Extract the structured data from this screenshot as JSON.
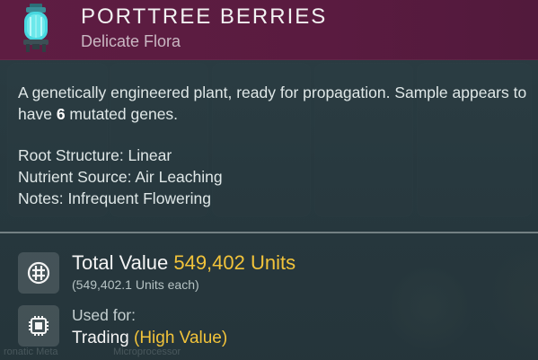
{
  "item": {
    "title": "PORTTREE BERRIES",
    "category": "Delicate Flora",
    "icon": "cryo-capsule-icon"
  },
  "description": {
    "text_before": "A genetically engineered plant, ready for propagation. Sample appears to have ",
    "gene_count": "6",
    "text_after": " mutated genes."
  },
  "properties": [
    "Root Structure: Linear",
    "Nutrient Source: Air Leaching",
    "Notes: Infrequent Flowering"
  ],
  "value": {
    "label": "Total Value",
    "amount": "549,402 Units",
    "each": "(549,402.1 Units each)",
    "icon": "units-currency-icon"
  },
  "usage": {
    "label": "Used for:",
    "purpose": "Trading",
    "tag": "(High Value)",
    "icon": "trade-chip-icon"
  },
  "background": {
    "labels": [
      "ronatic Meta",
      "Microprocessor"
    ]
  },
  "colors": {
    "header": "#5e1d42",
    "accent": "#f2c33a",
    "panel": "#283a40"
  }
}
